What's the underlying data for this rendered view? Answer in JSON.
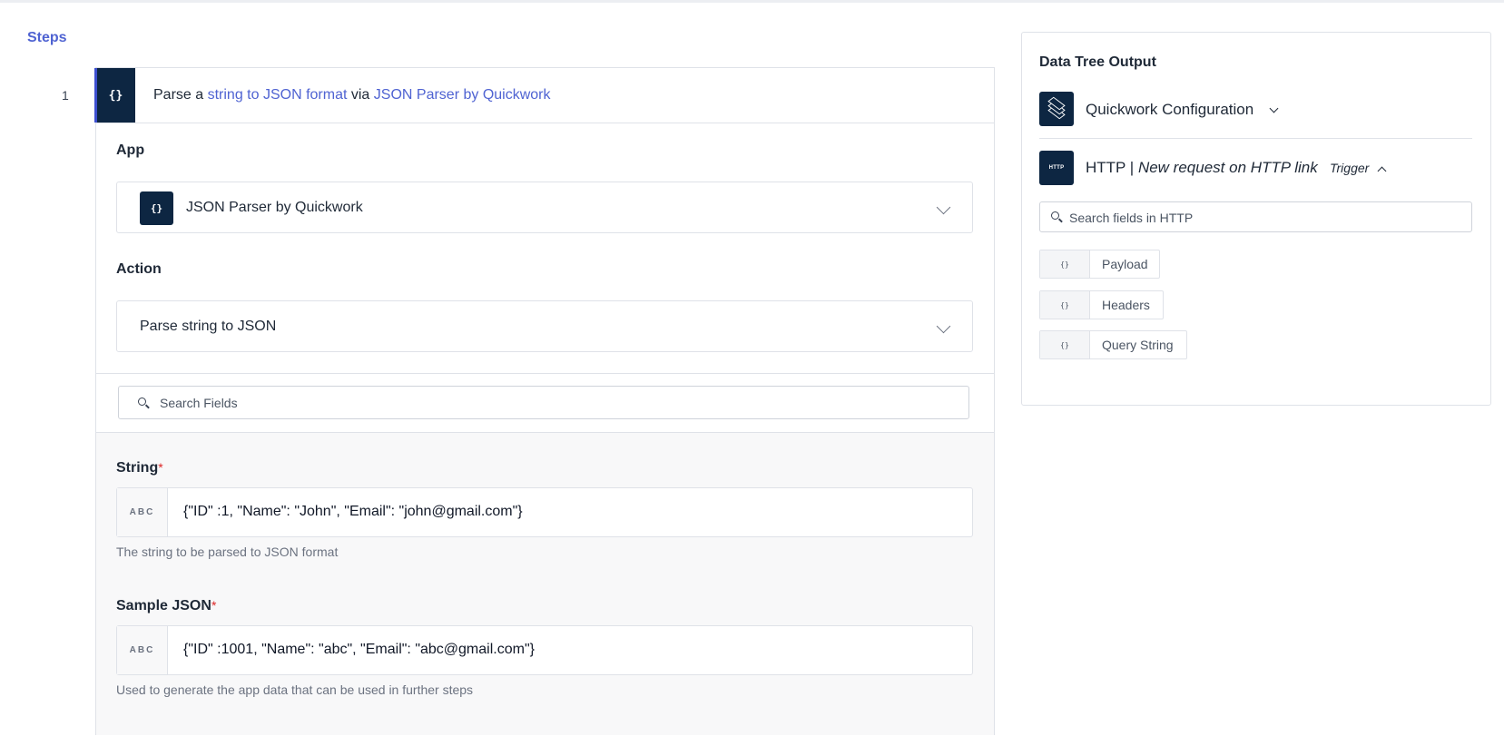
{
  "steps_title": "Steps",
  "step": {
    "number": "1",
    "icon": "{}",
    "text_prefix": "Parse a",
    "text_link1": "string to JSON format",
    "text_mid": "via",
    "text_link2": "JSON Parser by Quickwork"
  },
  "app": {
    "label": "App",
    "icon": "{}",
    "value": "JSON Parser by Quickwork"
  },
  "action": {
    "label": "Action",
    "value": "Parse string to JSON"
  },
  "search_fields": {
    "placeholder": "Search Fields"
  },
  "fields": [
    {
      "label": "String",
      "required": "*",
      "type_badge": "ABC",
      "value": "{\"ID\" :1, \"Name\": \"John\", \"Email\": \"john@gmail.com\"}",
      "help": "The string to be parsed to JSON format"
    },
    {
      "label": "Sample JSON",
      "required": "*",
      "type_badge": "ABC",
      "value": "{\"ID\" :1001, \"Name\": \"abc\", \"Email\": \"abc@gmail.com\"}",
      "help": "Used to generate the app data that can be used in further steps"
    }
  ],
  "data_tree": {
    "title": "Data Tree Output",
    "config_label": "Quickwork Configuration",
    "http_icon": "HTTP",
    "http_app": "HTTP |",
    "http_event": "New request on HTTP link",
    "trigger_label": "Trigger",
    "search_placeholder": "Search fields in HTTP",
    "chip_icon": "{}",
    "chips": [
      "Payload",
      "Headers",
      "Query String"
    ]
  },
  "colors": {
    "accent": "#4f63d2",
    "dark_icon": "#0d2642",
    "required": "#dc2626"
  },
  "icons": [
    "curly-braces-icon",
    "chevron-down-icon",
    "search-icon",
    "layers-icon",
    "http-icon",
    "chevron-up-icon"
  ]
}
